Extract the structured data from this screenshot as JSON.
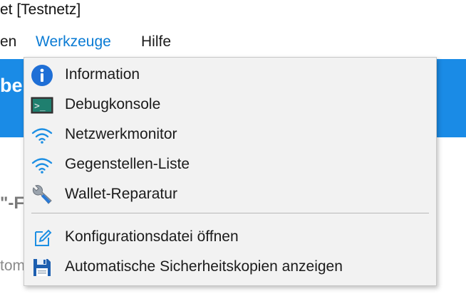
{
  "window": {
    "title": "et [Testnetz]"
  },
  "menubar": {
    "items": [
      "en",
      "Werkzeuge",
      "Hilfe"
    ]
  },
  "background": {
    "banner_text": "be",
    "heading_fragment": "\"-F",
    "text_fragment": "tom"
  },
  "menu": {
    "items": [
      {
        "label": "Information",
        "icon": "info-icon"
      },
      {
        "label": "Debugkonsole",
        "icon": "console-icon"
      },
      {
        "label": "Netzwerkmonitor",
        "icon": "wifi-icon"
      },
      {
        "label": "Gegenstellen-Liste",
        "icon": "wifi-icon"
      },
      {
        "label": "Wallet-Reparatur",
        "icon": "wrench-icon"
      },
      {
        "label": "Konfigurationsdatei öffnen",
        "icon": "edit-icon"
      },
      {
        "label": "Automatische Sicherheitskopien anzeigen",
        "icon": "floppy-disk-icon"
      }
    ]
  },
  "colors": {
    "accent": "#0a7bd4",
    "banner": "#1a8be6",
    "menu_bg": "#f2f2f2"
  }
}
